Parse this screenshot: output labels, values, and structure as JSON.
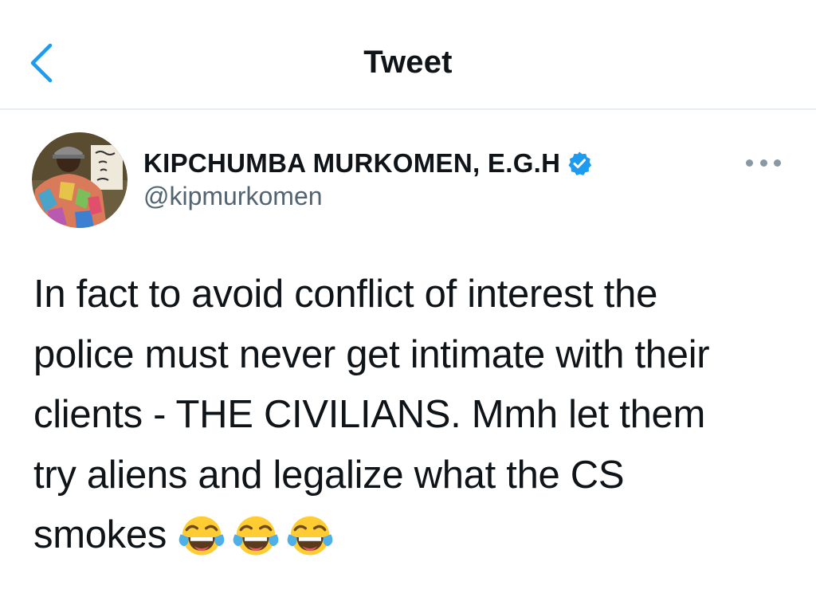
{
  "header": {
    "back_icon": "chevron-left-icon",
    "title": "Tweet"
  },
  "tweet": {
    "author": {
      "name": "KIPCHUMBA MURKOMEN, E.G.H",
      "handle": "@kipmurkomen",
      "verified": true,
      "avatar_icon": "user-avatar"
    },
    "more_icon": "more-options-icon",
    "text_lines": [
      "In fact to avoid conflict of interest the",
      "police must never get intimate with their",
      "clients - THE CIVILIANS. Mmh let them",
      "try aliens and legalize what the CS",
      "smokes"
    ],
    "emojis": [
      "face-with-tears-of-joy",
      "face-with-tears-of-joy",
      "face-with-tears-of-joy"
    ]
  },
  "colors": {
    "accent": "#1d9bf0",
    "text_primary": "#0f1419",
    "text_secondary": "#536471",
    "divider": "#e6ecf0"
  }
}
